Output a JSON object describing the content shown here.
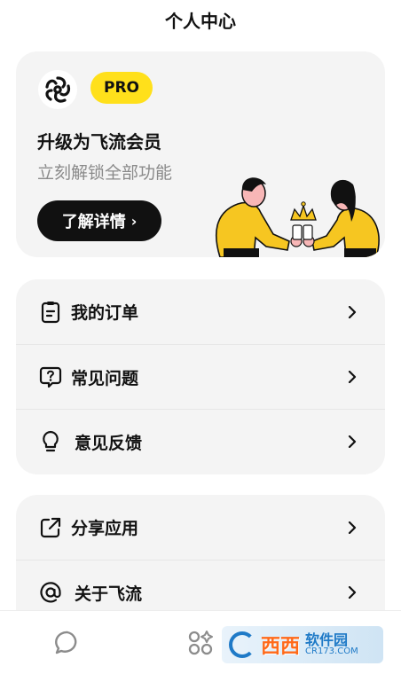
{
  "header": {
    "title": "个人中心"
  },
  "promo": {
    "badge": "PRO",
    "title": "升级为飞流会员",
    "subtitle": "立刻解锁全部功能",
    "button_label": "了解详情",
    "button_chevron": "›",
    "accent_color": "#ffe01b"
  },
  "menu_group_1": [
    {
      "label": "我的订单",
      "icon": "order-list-icon"
    },
    {
      "label": "常见问题",
      "icon": "question-icon"
    },
    {
      "label": "意见反馈",
      "icon": "lightbulb-icon"
    }
  ],
  "menu_group_2": [
    {
      "label": "分享应用",
      "icon": "share-icon"
    },
    {
      "label": "关于飞流",
      "icon": "at-icon"
    }
  ],
  "tabbar": {
    "tabs": [
      {
        "icon": "chat-bubble-icon"
      },
      {
        "icon": "apps-grid-icon"
      }
    ]
  },
  "watermark": {
    "text": "西西",
    "brand": "软件园",
    "site": "CR173.COM"
  }
}
